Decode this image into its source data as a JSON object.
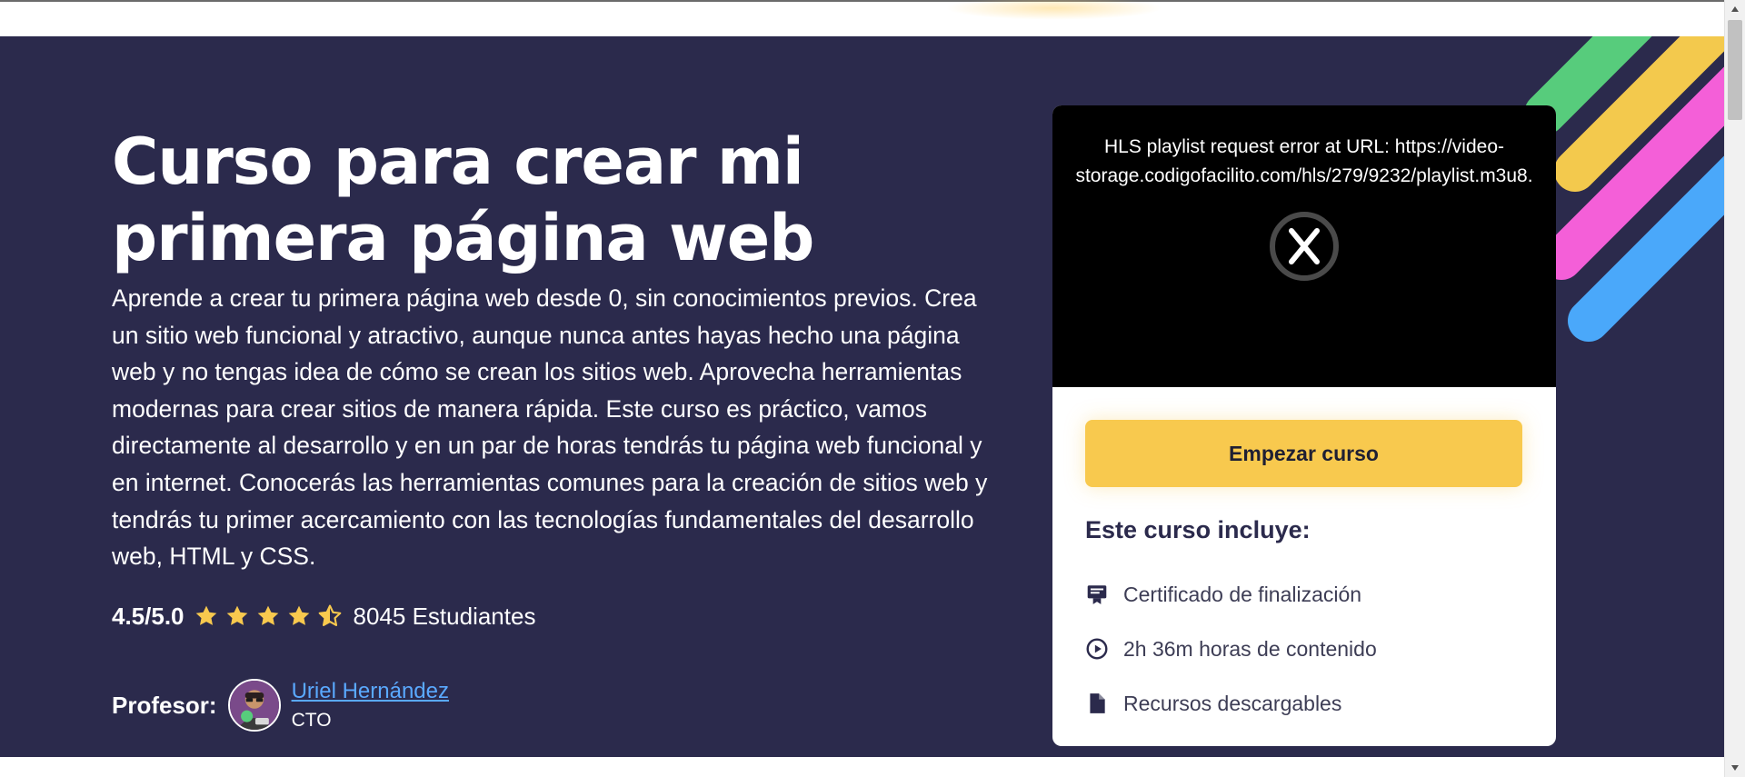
{
  "course": {
    "title": "Curso para crear mi primera página web",
    "description": "Aprende a crear tu primera página web desde 0, sin conocimientos previos. Crea un sitio web funcional y atractivo, aunque nunca antes hayas hecho una página web y no tengas idea de cómo se crean los sitios web. Aprovecha herramientas modernas para crear sitios de manera rápida. Este curso es práctico, vamos directamente al desarrollo y en un par de horas tendrás tu página web funcional y en internet. Conocerás las herramientas comunes para la creación de sitios web y tendrás tu primer acercamiento con las tecnologías fundamentales del desarrollo web, HTML y CSS.",
    "rating": {
      "value_label": "4.5/5.0",
      "stars": 4.5,
      "max_stars": 5,
      "students_label": "8045 Estudiantes"
    },
    "teacher": {
      "label": "Profesor:",
      "name": "Uriel Hernández",
      "role": "CTO"
    }
  },
  "video": {
    "error_message": "HLS playlist request error at URL: https://video-storage.codigofacilito.com/hls/279/9232/playlist.m3u8.",
    "error_icon": "close-circle-icon"
  },
  "card": {
    "start_button_label": "Empezar curso",
    "includes_title": "Este curso incluye:",
    "includes": [
      {
        "icon": "certificate-icon",
        "label": "Certificado de finalización"
      },
      {
        "icon": "play-circle-icon",
        "label": "2h 36m  horas de contenido"
      },
      {
        "icon": "file-icon",
        "label": "Recursos descargables"
      }
    ]
  },
  "colors": {
    "hero_background": "#2b2a4c",
    "accent_yellow": "#f8c94e",
    "link_blue": "#5aa9ff",
    "stripe_green": "#57cc7c",
    "stripe_yellow": "#f3c94d",
    "stripe_pink": "#f45fd8",
    "stripe_blue": "#4aa8fa"
  }
}
